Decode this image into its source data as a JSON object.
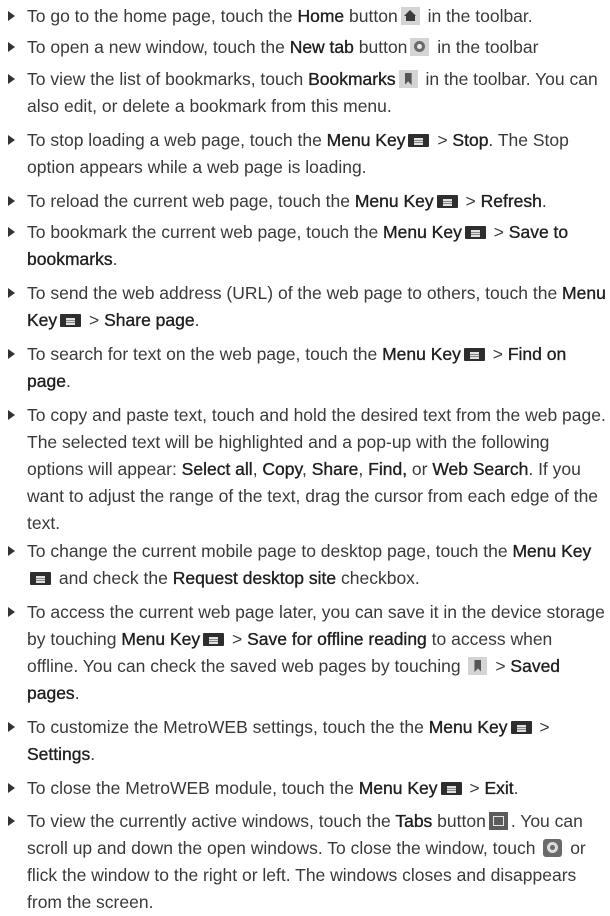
{
  "items": [
    {
      "t1": "To go to the home page, touch the ",
      "b1": "Home",
      "t2": " button",
      "icon": "home-icon",
      "t3": " in the toolbar."
    },
    {
      "t1": "To open a new window, touch the ",
      "b1": "New tab",
      "t2": " button",
      "icon": "new-tab-icon",
      "t3": " in the toolbar"
    },
    {
      "t1": "To view the list of bookmarks, touch ",
      "b1": "Bookmarks",
      "icon": "bookmark-icon",
      "t2": " in the toolbar. You can also edit, or delete a bookmark from this menu."
    },
    {
      "t1": "To stop loading a web page, touch the ",
      "b1": "Menu Key",
      "icon": "menu-key-icon",
      "t2": " > ",
      "b2": "Stop",
      "t3": ". The Stop option appears while a web page is loading."
    },
    {
      "t1": "To reload the current web page, touch the ",
      "b1": "Menu Key",
      "icon": "menu-key-icon",
      "t2": " > ",
      "b2": "Refresh",
      "t3": "."
    },
    {
      "t1": "To bookmark the current web page, touch the ",
      "b1": "Menu Key",
      "icon": "menu-key-icon",
      "t2": " > ",
      "b2": "Save to bookmarks",
      "t3": "."
    },
    {
      "t1": "To send the web address (URL) of the web page to others, touch the ",
      "b1": "Menu Key",
      "icon": "menu-key-icon",
      "t2": " > ",
      "b2": "Share page",
      "t3": "."
    },
    {
      "t1": "To search for text on the web page, touch the ",
      "b1": "Menu Key",
      "icon": "menu-key-icon",
      "t2": " > ",
      "b2": "Find on page",
      "t3": "."
    },
    {
      "t1": "To copy and paste text, touch and hold the desired text from the web page. The selected text will be highlighted and a pop-up with the following options will appear: ",
      "b1": "Select all",
      "t2": ", ",
      "b2": "Copy",
      "t3": ", ",
      "b3": "Share",
      "t4": ", ",
      "b4": "Find,",
      "t5": " or ",
      "b5": "Web Search",
      "t6": ". If you want to adjust the range of the text, drag the cursor from each edge of the text."
    },
    {
      "t1": "To change the current mobile page to desktop page, touch the ",
      "b1": "Menu Key",
      "icon": "menu-key-icon",
      "t2": " and check the ",
      "b2": "Request desktop site",
      "t3": " checkbox."
    },
    {
      "t1": "To access the current web page later, you can save it in the device storage by touching ",
      "b1": "Menu Key",
      "icon": "menu-key-icon",
      "t2": " > ",
      "b2": "Save for offline reading",
      "t3": " to access when offline. You can check the saved web pages by touching ",
      "icon2": "bookmark-icon",
      "t4": " > ",
      "b3": "Saved pages",
      "t5": "."
    },
    {
      "t1": "To customize the MetroWEB settings, touch the the ",
      "b1": "Menu Key",
      "icon": "menu-key-icon",
      "t2": " > ",
      "b2": "Settings",
      "t3": "."
    },
    {
      "t1": "To close the MetroWEB module, touch the ",
      "b1": "Menu Key",
      "icon": "menu-key-icon",
      "t2": " > ",
      "b2": "Exit",
      "t3": "."
    },
    {
      "t1": "To view the currently active windows, touch the ",
      "b1": "Tabs",
      "t2": " button",
      "icon": "tabs-icon",
      "t3": ". You can scroll up and down the open windows. To close the window, touch ",
      "icon2": "close-window-icon",
      "t4": " or flick the window to the right or left. The windows closes and disappears from the screen."
    }
  ]
}
